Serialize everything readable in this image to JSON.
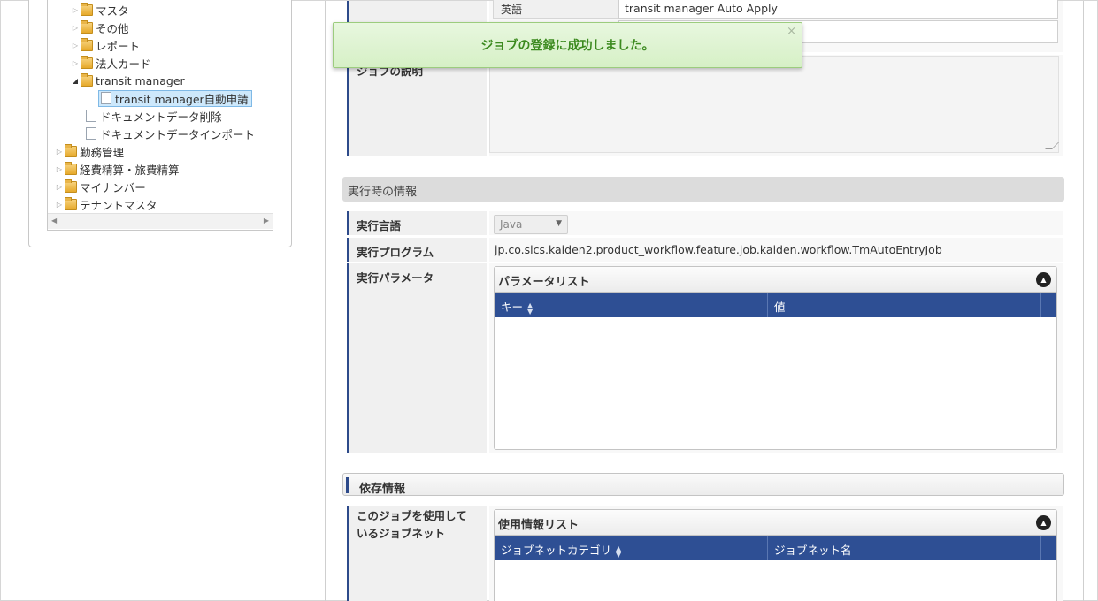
{
  "tree": {
    "items": [
      {
        "label": "マスタ",
        "type": "folder",
        "state": "collapsed"
      },
      {
        "label": "その他",
        "type": "folder",
        "state": "collapsed"
      },
      {
        "label": "レポート",
        "type": "folder",
        "state": "collapsed"
      },
      {
        "label": "法人カード",
        "type": "folder",
        "state": "collapsed"
      },
      {
        "label": "transit manager",
        "type": "folder",
        "state": "expanded"
      },
      {
        "label": "transit manager自動申請",
        "type": "document",
        "selected": true
      },
      {
        "label": "ドキュメントデータ削除",
        "type": "document"
      },
      {
        "label": "ドキュメントデータインポート",
        "type": "document"
      },
      {
        "label": "勤務管理",
        "type": "folder",
        "state": "collapsed"
      },
      {
        "label": "経費精算・旅費精算",
        "type": "folder",
        "state": "collapsed"
      },
      {
        "label": "マイナンバー",
        "type": "folder",
        "state": "collapsed"
      },
      {
        "label": "テナントマスタ",
        "type": "folder",
        "state": "collapsed"
      }
    ]
  },
  "job_name": {
    "english_label": "英語",
    "english_value": "transit manager Auto Apply"
  },
  "job_description": {
    "label": "ジョブの説明"
  },
  "execution": {
    "section_title": "実行時の情報",
    "language_label": "実行言語",
    "language_value": "Java",
    "program_label": "実行プログラム",
    "program_value": "jp.co.slcs.kaiden2.product_workflow.feature.job.kaiden.workflow.TmAutoEntryJob",
    "params_label": "実行パラメータ",
    "params_list_title": "パラメータリスト",
    "params_columns": [
      "キー",
      "値"
    ]
  },
  "dependency": {
    "section_title": "依存情報",
    "usage_label": "このジョブを使用しているジョブネット",
    "usage_list_title": "使用情報リスト",
    "usage_columns": [
      "ジョブネットカテゴリ",
      "ジョブネット名"
    ]
  },
  "toast": {
    "message": "ジョブの登録に成功しました。",
    "close_glyph": "×"
  },
  "colors": {
    "accent": "#2d4a8a",
    "grid_header": "#2e4f94",
    "toast_text": "#3c8a1f",
    "toast_bg": "#dff3d2"
  }
}
